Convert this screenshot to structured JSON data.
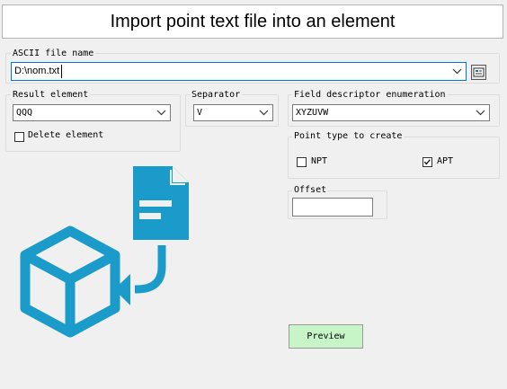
{
  "dialog": {
    "title": "Import point text file into an element"
  },
  "ascii_file": {
    "label": "ASCII file name",
    "value": "D:\\nom.txt",
    "browse_icon": "file-browse-icon"
  },
  "result_element": {
    "label": "Result element",
    "value": "QQQ"
  },
  "delete_element": {
    "label": "Delete element",
    "checked": false
  },
  "separator": {
    "label": "Separator",
    "value": "V"
  },
  "field_descriptor": {
    "label": "Field descriptor enumeration",
    "value": "XYZUVW"
  },
  "point_type": {
    "label": "Point type to create",
    "npt": {
      "label": "NPT",
      "checked": false
    },
    "apt": {
      "label": "APT",
      "checked": true
    }
  },
  "offset": {
    "label": "Offset",
    "value": ""
  },
  "preview_button": {
    "label": "Preview"
  },
  "colors": {
    "icon_blue": "#1a9bc9",
    "preview_bg": "#c8f5c8"
  }
}
